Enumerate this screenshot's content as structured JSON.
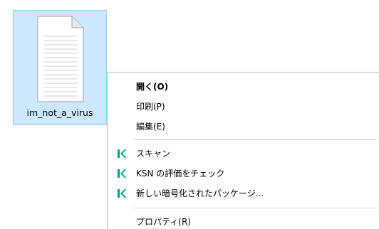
{
  "desktop": {
    "file": {
      "label": "im_not_a_virus",
      "icon": "text-document-icon",
      "selected": true
    }
  },
  "context_menu": {
    "items": [
      {
        "label": "開く(O)",
        "bold": true,
        "icon": null
      },
      {
        "label": "印刷(P)",
        "bold": false,
        "icon": null
      },
      {
        "label": "編集(E)",
        "bold": false,
        "icon": null
      },
      {
        "label": "スキャン",
        "bold": false,
        "icon": "kaspersky-k-icon"
      },
      {
        "label": "KSN の評価をチェック",
        "bold": false,
        "icon": "kaspersky-k-icon"
      },
      {
        "label": "新しい暗号化されたパッケージ...",
        "bold": false,
        "icon": "kaspersky-k-icon"
      },
      {
        "label": "プロパティ(R)",
        "bold": false,
        "icon": null
      }
    ]
  },
  "colors": {
    "selection_background": "#cce8ff",
    "selection_border": "#99d1ff",
    "kaspersky_green": "#00a88e"
  }
}
